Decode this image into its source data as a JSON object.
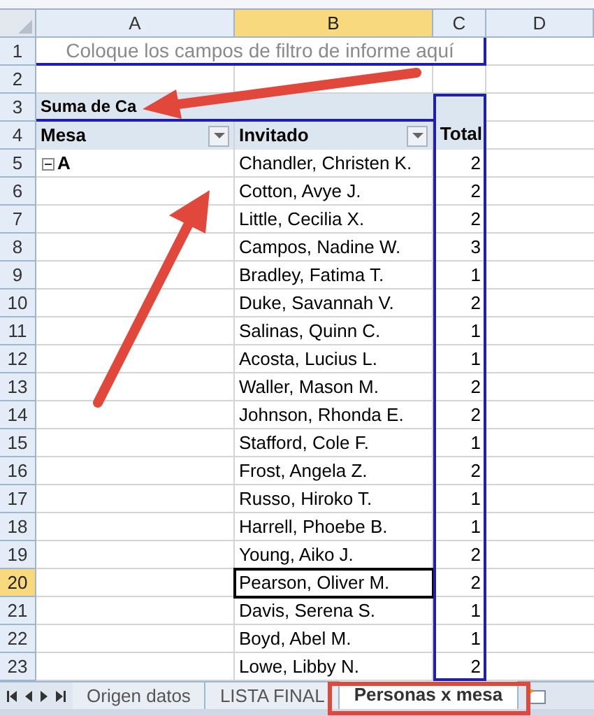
{
  "columns": [
    {
      "label": "A",
      "selected": false
    },
    {
      "label": "B",
      "selected": true
    },
    {
      "label": "C",
      "selected": false
    },
    {
      "label": "D",
      "selected": false
    }
  ],
  "row_headers": [
    {
      "label": "1",
      "selected": false
    },
    {
      "label": "2",
      "selected": false
    },
    {
      "label": "3",
      "selected": false
    },
    {
      "label": "4",
      "selected": false
    },
    {
      "label": "5",
      "selected": false
    },
    {
      "label": "6",
      "selected": false
    },
    {
      "label": "7",
      "selected": false
    },
    {
      "label": "8",
      "selected": false
    },
    {
      "label": "9",
      "selected": false
    },
    {
      "label": "10",
      "selected": false
    },
    {
      "label": "11",
      "selected": false
    },
    {
      "label": "12",
      "selected": false
    },
    {
      "label": "13",
      "selected": false
    },
    {
      "label": "14",
      "selected": false
    },
    {
      "label": "15",
      "selected": false
    },
    {
      "label": "16",
      "selected": false
    },
    {
      "label": "17",
      "selected": false
    },
    {
      "label": "18",
      "selected": false
    },
    {
      "label": "19",
      "selected": false
    },
    {
      "label": "20",
      "selected": true
    },
    {
      "label": "21",
      "selected": false
    },
    {
      "label": "22",
      "selected": false
    },
    {
      "label": "23",
      "selected": false
    }
  ],
  "pivot": {
    "filter_hint": "Coloque los campos de filtro de informe aquí",
    "value_label": "Suma de Ca",
    "row_fields": [
      "Mesa",
      "Invitado"
    ],
    "total_header": "Total",
    "group": {
      "label": "A",
      "expanded": true
    },
    "entries": [
      {
        "guest": "Chandler, Christen K.",
        "total": "2",
        "selected": false
      },
      {
        "guest": "Cotton, Avye J.",
        "total": "2",
        "selected": false
      },
      {
        "guest": "Little, Cecilia X.",
        "total": "2",
        "selected": false
      },
      {
        "guest": "Campos, Nadine W.",
        "total": "3",
        "selected": false
      },
      {
        "guest": "Bradley, Fatima T.",
        "total": "1",
        "selected": false
      },
      {
        "guest": "Duke, Savannah V.",
        "total": "2",
        "selected": false
      },
      {
        "guest": "Salinas, Quinn C.",
        "total": "1",
        "selected": false
      },
      {
        "guest": "Acosta, Lucius L.",
        "total": "1",
        "selected": false
      },
      {
        "guest": "Waller, Mason M.",
        "total": "2",
        "selected": false
      },
      {
        "guest": "Johnson, Rhonda E.",
        "total": "2",
        "selected": false
      },
      {
        "guest": "Stafford, Cole F.",
        "total": "1",
        "selected": false
      },
      {
        "guest": "Frost, Angela Z.",
        "total": "2",
        "selected": false
      },
      {
        "guest": "Russo, Hiroko T.",
        "total": "1",
        "selected": false
      },
      {
        "guest": "Harrell, Phoebe B.",
        "total": "1",
        "selected": false
      },
      {
        "guest": "Young, Aiko J.",
        "total": "2",
        "selected": false
      },
      {
        "guest": "Pearson, Oliver M.",
        "total": "2",
        "selected": true
      },
      {
        "guest": "Davis, Serena S.",
        "total": "1",
        "selected": false
      },
      {
        "guest": "Boyd, Abel M.",
        "total": "1",
        "selected": false
      },
      {
        "guest": "Lowe, Libby N.",
        "total": "2",
        "selected": false
      }
    ]
  },
  "sheet_tabs": [
    {
      "label": "Origen datos",
      "selected": false
    },
    {
      "label": "LISTA FINAL",
      "selected": false
    },
    {
      "label": "Personas x mesa",
      "selected": true
    }
  ]
}
